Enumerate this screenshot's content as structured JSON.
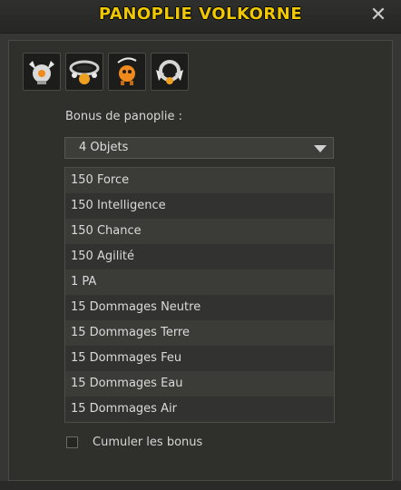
{
  "window": {
    "title": "PANOPLIE VOLKORNE",
    "close_icon": "close-icon",
    "accent_color": "#f0c800"
  },
  "items": [
    {
      "icon": "winged-helmet-icon"
    },
    {
      "icon": "amulet-belt-icon"
    },
    {
      "icon": "orange-pet-icon"
    },
    {
      "icon": "winged-ring-icon"
    }
  ],
  "bonus": {
    "label": "Bonus de panoplie :",
    "selected": "4 Objets",
    "rows": [
      "150 Force",
      "150 Intelligence",
      "150 Chance",
      "150 Agilité",
      "1 PA",
      "15 Dommages Neutre",
      "15 Dommages Terre",
      "15 Dommages Feu",
      "15 Dommages Eau",
      "15 Dommages Air"
    ]
  },
  "cumul": {
    "label": "Cumuler les bonus",
    "checked": false
  }
}
